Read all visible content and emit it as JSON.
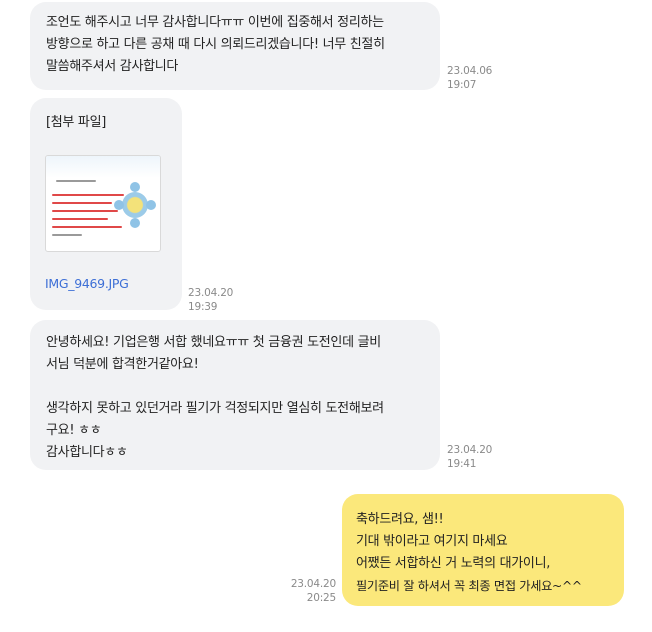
{
  "messages": [
    {
      "lines": [
        "조언도 해주시고 너무 감사합니다ㅠㅠ 이번에 집중해서 정리하는",
        "방향으로 하고 다른 공채 때 다시 의뢰드리겠습니다! 너무 친절히",
        "말씀해주셔서 감사합니다"
      ],
      "date": "23.04.06",
      "time": "19:07"
    },
    {
      "attachment_label": "[첨부 파일]",
      "filename": "IMG_9469.JPG",
      "date": "23.04.20",
      "time": "19:39"
    },
    {
      "lines": [
        "안녕하세요! 기업은행 서합 했네요ㅠㅠ 첫 금융권 도전인데 글비",
        "서님 덕분에 합격한거같아요!",
        "",
        "생각하지 못하고 있던거라 필기가 걱정되지만 열심히 도전해보려",
        "구요! ㅎㅎ",
        "감사합니다ㅎㅎ"
      ],
      "date": "23.04.20",
      "time": "19:41"
    },
    {
      "lines": [
        "축하드려요, 샘!!",
        "기대 밖이라고 여기지 마세요",
        "어쨌든 서합하신 거 노력의 대가이니,",
        "필기준비 잘 하셔서 꼭 최종 면접 가세요~^^"
      ],
      "date": "23.04.20",
      "time": "20:25"
    }
  ],
  "colors": {
    "received_bubble": "#f1f2f4",
    "sent_bubble": "#fbe87b",
    "timestamp": "#8a8a8a",
    "file_link": "#3d6fd6"
  }
}
